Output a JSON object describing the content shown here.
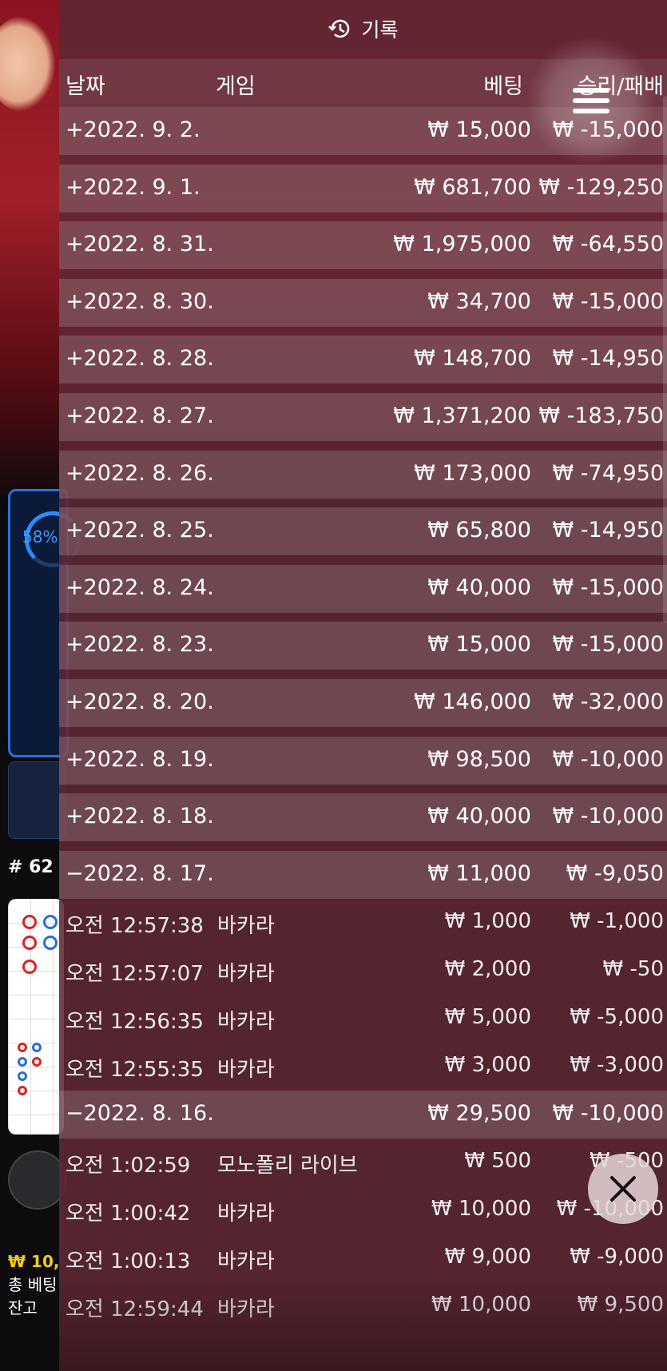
{
  "background": {
    "stat_percent": "58%",
    "round_number": "# 62",
    "balance_line": "₩ 10,",
    "total_bet_label": "총 베팅",
    "remaining_label": "잔고"
  },
  "panel": {
    "title": "기록",
    "title_icon": "history-clock-icon",
    "columns": {
      "date": "날짜",
      "game": "게임",
      "bet": "베팅",
      "result": "승리/패배"
    }
  },
  "rows": [
    {
      "kind": "date",
      "date": "+2022. 9. 2.",
      "bet": "₩ 15,000",
      "result": "₩ -15,000"
    },
    {
      "kind": "date",
      "date": "+2022. 9. 1.",
      "bet": "₩ 681,700",
      "result": "₩ -129,250"
    },
    {
      "kind": "date",
      "date": "+2022. 8. 31.",
      "bet": "₩ 1,975,000",
      "result": "₩ -64,550"
    },
    {
      "kind": "date",
      "date": "+2022. 8. 30.",
      "bet": "₩ 34,700",
      "result": "₩ -15,000"
    },
    {
      "kind": "date",
      "date": "+2022. 8. 28.",
      "bet": "₩ 148,700",
      "result": "₩ -14,950"
    },
    {
      "kind": "date",
      "date": "+2022. 8. 27.",
      "bet": "₩ 1,371,200",
      "result": "₩ -183,750"
    },
    {
      "kind": "date",
      "date": "+2022. 8. 26.",
      "bet": "₩ 173,000",
      "result": "₩ -74,950"
    },
    {
      "kind": "date",
      "date": "+2022. 8. 25.",
      "bet": "₩ 65,800",
      "result": "₩ -14,950"
    },
    {
      "kind": "date",
      "date": "+2022. 8. 24.",
      "bet": "₩ 40,000",
      "result": "₩ -15,000"
    },
    {
      "kind": "date",
      "date": "+2022. 8. 23.",
      "bet": "₩ 15,000",
      "result": "₩ -15,000"
    },
    {
      "kind": "date",
      "date": "+2022. 8. 20.",
      "bet": "₩ 146,000",
      "result": "₩ -32,000"
    },
    {
      "kind": "date",
      "date": "+2022. 8. 19.",
      "bet": "₩ 98,500",
      "result": "₩ -10,000"
    },
    {
      "kind": "date",
      "date": "+2022. 8. 18.",
      "bet": "₩ 40,000",
      "result": "₩ -10,000"
    },
    {
      "kind": "date",
      "open": true,
      "date": "−2022. 8. 17.",
      "bet": "₩ 11,000",
      "result": "₩ -9,050"
    },
    {
      "kind": "game",
      "time": "오전 12:57:38",
      "game": "바카라",
      "bet": "₩ 1,000",
      "result": "₩ -1,000"
    },
    {
      "kind": "game",
      "time": "오전 12:57:07",
      "game": "바카라",
      "bet": "₩ 2,000",
      "result": "₩ -50"
    },
    {
      "kind": "game",
      "time": "오전 12:56:35",
      "game": "바카라",
      "bet": "₩ 5,000",
      "result": "₩ -5,000"
    },
    {
      "kind": "game",
      "time": "오전 12:55:35",
      "game": "바카라",
      "bet": "₩ 3,000",
      "result": "₩ -3,000"
    },
    {
      "kind": "date",
      "open": true,
      "date": "−2022. 8. 16.",
      "bet": "₩ 29,500",
      "result": "₩ -10,000"
    },
    {
      "kind": "game",
      "time": "오전 1:02:59",
      "game": "모노폴리 라이브",
      "bet": "₩ 500",
      "result": "₩ -500"
    },
    {
      "kind": "game",
      "time": "오전 1:00:42",
      "game": "바카라",
      "bet": "₩ 10,000",
      "result": "₩ -10,000"
    },
    {
      "kind": "game",
      "time": "오전 1:00:13",
      "game": "바카라",
      "bet": "₩ 9,000",
      "result": "₩ -9,000"
    },
    {
      "kind": "game",
      "time": "오전 12:59:44",
      "game": "바카라",
      "bet": "₩ 10,000",
      "result": "₩ 9,500"
    }
  ],
  "controls": {
    "menu_icon": "hamburger-menu-icon",
    "close_icon": "close-icon"
  }
}
